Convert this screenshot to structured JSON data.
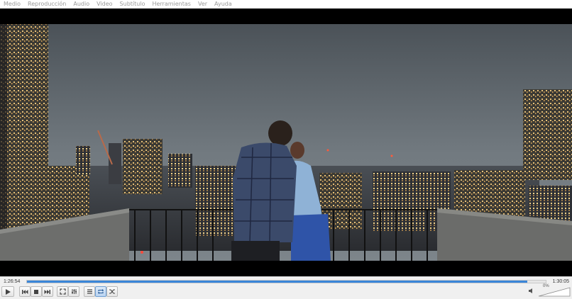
{
  "menu": [
    "Medio",
    "Reproducción",
    "Audio",
    "Video",
    "Subtítulo",
    "Herramientas",
    "Ver",
    "Ayuda"
  ],
  "player": {
    "elapsed": "1:26:54",
    "total": "1:30:05",
    "progress": 0.965,
    "volume_label": "0%",
    "volume_level": 0.0
  },
  "icons": {
    "play": "play-icon",
    "prev": "previous-icon",
    "stop": "stop-icon",
    "next": "next-icon",
    "fullscreen": "fullscreen-icon",
    "extended": "equalizer-icon",
    "playlist": "playlist-icon",
    "loop": "loop-icon",
    "shuffle": "shuffle-icon",
    "volume": "speaker-icon"
  },
  "colors": {
    "accent": "#3a86d8"
  }
}
